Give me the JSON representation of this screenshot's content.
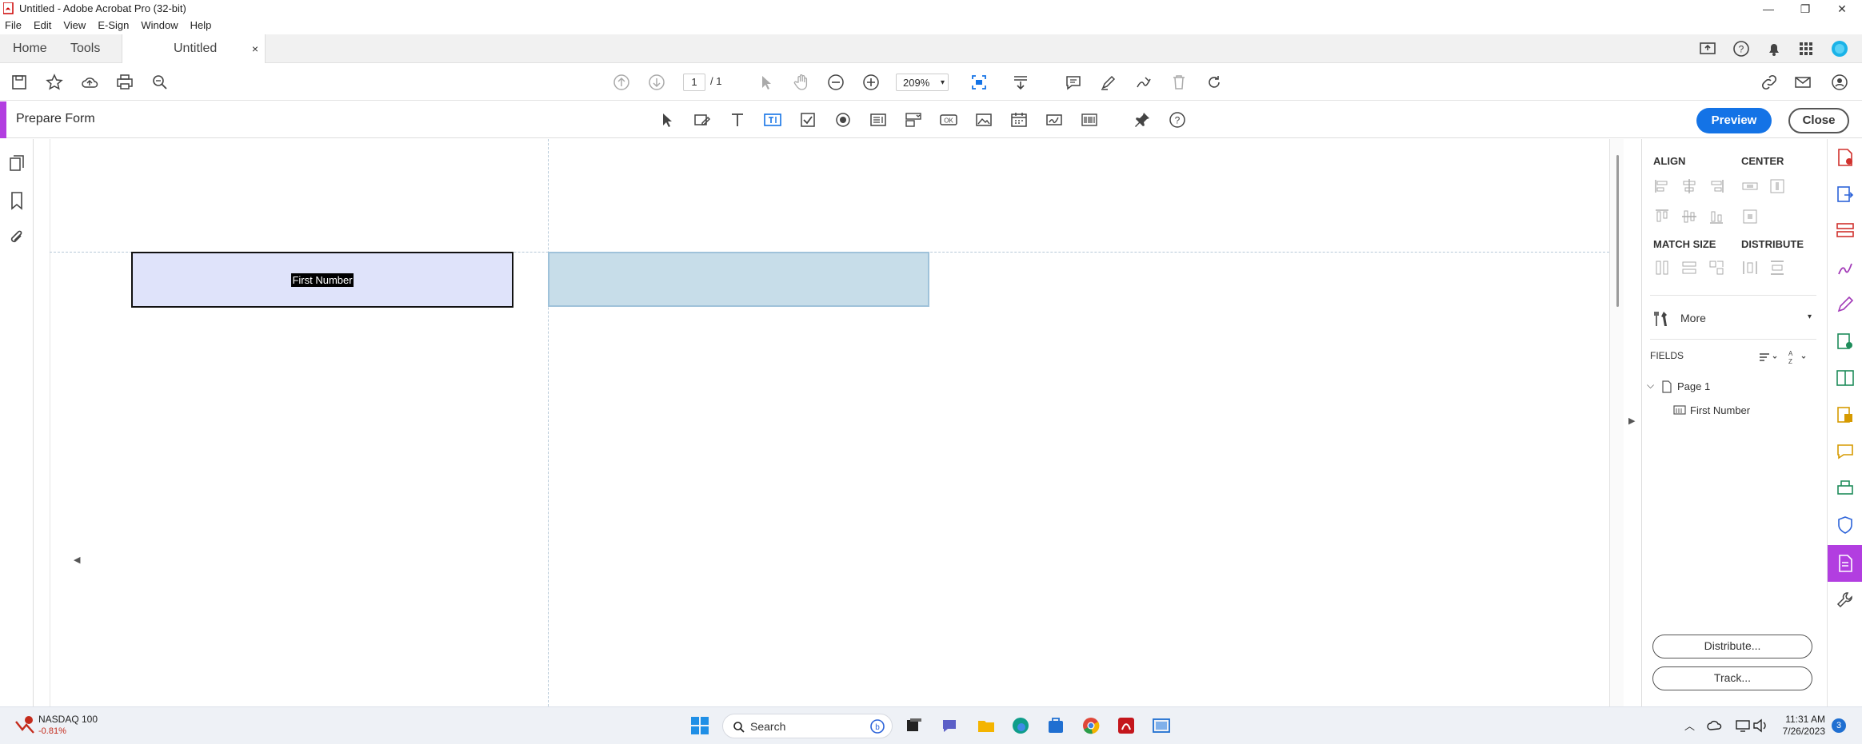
{
  "window": {
    "title": "Untitled - Adobe Acrobat Pro (32-bit)"
  },
  "menu": [
    "File",
    "Edit",
    "View",
    "E-Sign",
    "Window",
    "Help"
  ],
  "tabs": {
    "home": "Home",
    "tools": "Tools",
    "document": "Untitled",
    "close_symbol": "×"
  },
  "toolbar": {
    "page_current": "1",
    "page_total": "/ 1",
    "zoom": "209%"
  },
  "prepare_form": {
    "label": "Prepare Form",
    "preview": "Preview",
    "close": "Close"
  },
  "document": {
    "field_label": "First Number"
  },
  "right_panel": {
    "align": "ALIGN",
    "center": "CENTER",
    "match_size": "MATCH SIZE",
    "distribute": "DISTRIBUTE",
    "more": "More",
    "fields": "FIELDS",
    "tree": {
      "page": "Page 1",
      "field": "First Number"
    },
    "distribute_btn": "Distribute...",
    "track_btn": "Track..."
  },
  "taskbar": {
    "stock_name": "NASDAQ 100",
    "stock_change": "-0.81%",
    "search": "Search",
    "time": "11:31 AM",
    "date": "7/26/2023",
    "notif_count": "3"
  },
  "colors": {
    "accent": "#b23ee0",
    "primary": "#1473e6",
    "field_fill": "#dfe3fa",
    "ghost_fill": "#c7dde9"
  }
}
